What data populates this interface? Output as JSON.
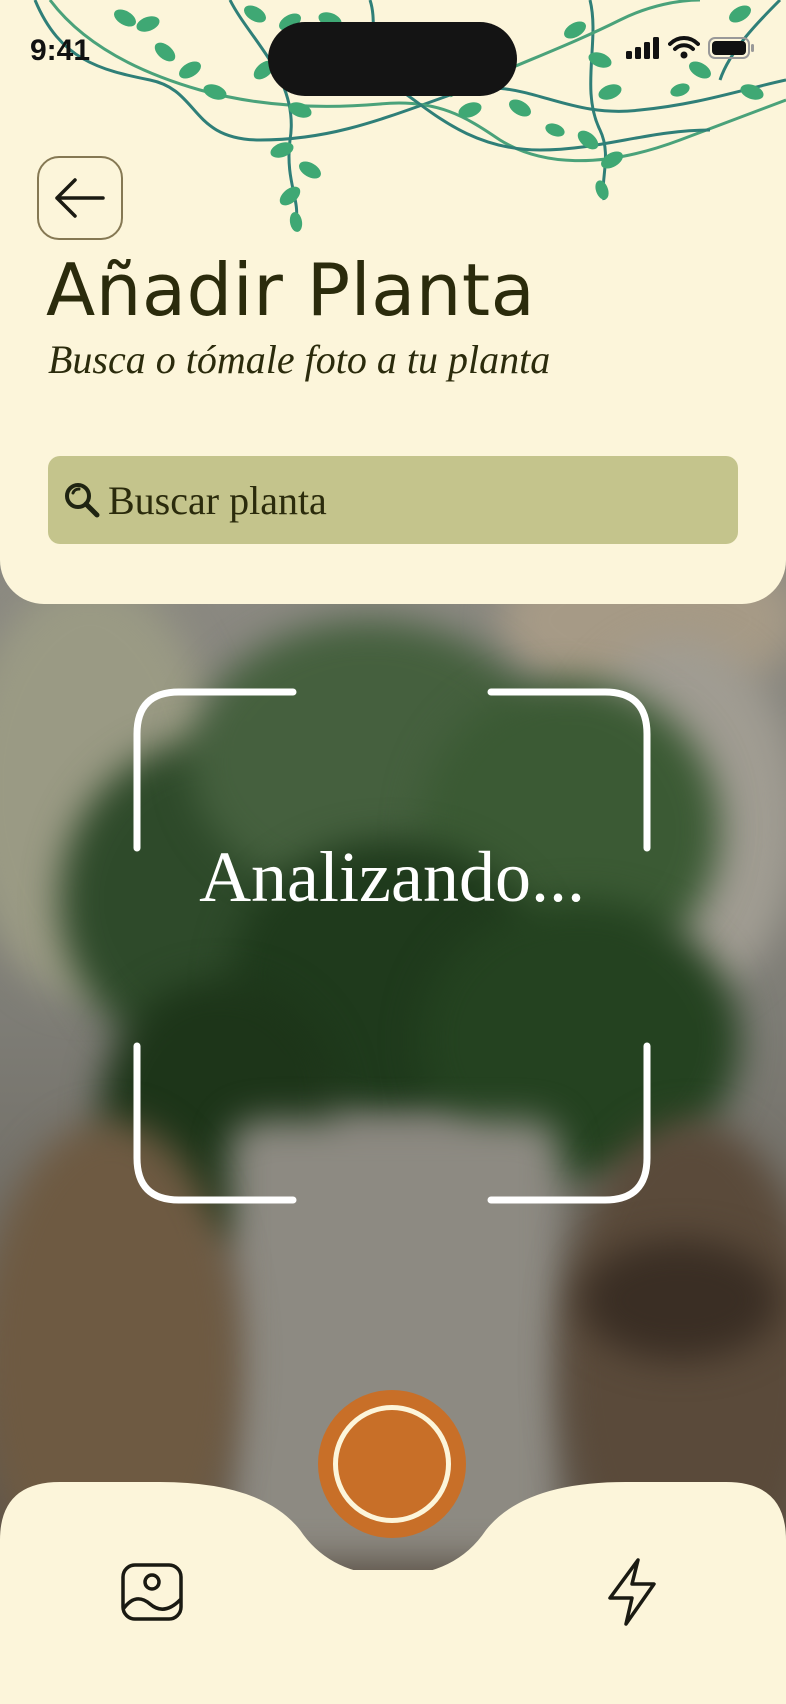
{
  "status_bar": {
    "time": "9:41"
  },
  "header": {
    "title": "Añadir Planta",
    "subtitle": "Busca o tómale foto a tu planta"
  },
  "search": {
    "placeholder": "Buscar planta"
  },
  "scanner": {
    "status": "Analizando..."
  },
  "icons": {
    "back": "arrow-left-icon",
    "search": "search-icon",
    "gallery": "image-icon",
    "flash": "flash-icon"
  },
  "colors": {
    "background": "#fcf5da",
    "search_bar": "#c4c48c",
    "accent": "#c86f28",
    "text": "#2b2b0c"
  }
}
